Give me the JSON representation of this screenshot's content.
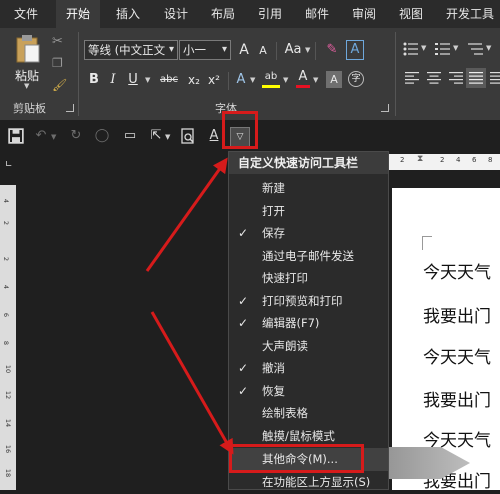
{
  "tabs": [
    "文件",
    "开始",
    "插入",
    "设计",
    "布局",
    "引用",
    "邮件",
    "审阅",
    "视图",
    "开发工具"
  ],
  "active_tab": "开始",
  "ribbon": {
    "paste_label": "粘贴",
    "clipboard_label": "剪贴板",
    "font_group_label": "字体",
    "font_name": "等线 (中文正文",
    "font_size": "小一",
    "grow_font": "A",
    "shrink_font": "A",
    "change_case": "Aa",
    "clear_format_glyph": "✎",
    "char_border_glyph": "A",
    "bold": "B",
    "italic": "I",
    "underline": "U",
    "strikethrough": "abc",
    "subscript": "x₂",
    "superscript": "x²",
    "text_effect": "A",
    "highlight": "ab",
    "font_color": "A",
    "char_shading": "A",
    "enclose_char": "字"
  },
  "ruler": {
    "h_numbers": [
      "2",
      "2",
      "4",
      "6",
      "8"
    ],
    "v_numbers": [
      "4",
      "2",
      "2",
      "4",
      "6",
      "8",
      "10",
      "12",
      "14",
      "16",
      "18"
    ]
  },
  "menu": {
    "title": "自定义快速访问工具栏",
    "items": [
      {
        "label": "新建",
        "checked": ""
      },
      {
        "label": "打开",
        "checked": ""
      },
      {
        "label": "保存",
        "checked": "✓"
      },
      {
        "label": "通过电子邮件发送",
        "checked": ""
      },
      {
        "label": "快速打印",
        "checked": ""
      },
      {
        "label": "打印预览和打印",
        "checked": "✓"
      },
      {
        "label": "编辑器(F7)",
        "checked": "✓"
      },
      {
        "label": "大声朗读",
        "checked": ""
      },
      {
        "label": "撤消",
        "checked": "✓"
      },
      {
        "label": "恢复",
        "checked": "✓"
      },
      {
        "label": "绘制表格",
        "checked": ""
      },
      {
        "label": "触摸/鼠标模式",
        "checked": ""
      },
      {
        "label": "其他命令(M)...",
        "checked": ""
      },
      {
        "label": "在功能区上方显示(S)",
        "checked": ""
      }
    ]
  },
  "document_lines": [
    "今天天气",
    "我要出门",
    "今天天气",
    "我要出门",
    "今天天气",
    "我要出门"
  ],
  "colors": {
    "highlight_red": "#d61b1b",
    "accent": "#d61b1b",
    "font_color_bar": "#e81123",
    "highlight_bar": "#ffff00"
  }
}
